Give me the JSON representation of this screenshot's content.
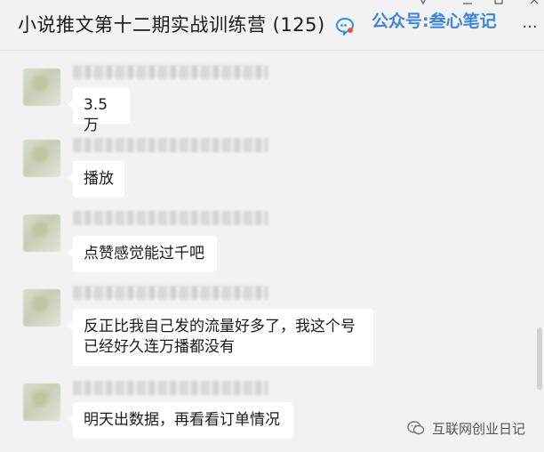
{
  "header": {
    "title": "小说推文第十二期实战训练营 (125)",
    "chat_icon": "chat-bubble-icon",
    "watermark": "公众号:叁心笔记",
    "window_controls": [
      "minimize-icon",
      "maximize-icon",
      "close-icon"
    ],
    "more_icon": "more-icon",
    "more_glyph": "···"
  },
  "messages": [
    {
      "sender": "blurred-name",
      "text": "3.5万"
    },
    {
      "sender": "blurred-name",
      "text": "播放"
    },
    {
      "sender": "blurred-name",
      "text": "点赞感觉能过千吧"
    },
    {
      "sender": "blurred-name",
      "text": "反正比我自己发的流量好多了，我这个号\n已经好久连万播都没有"
    },
    {
      "sender": "blurred-name",
      "text": "明天出数据，再看看订单情况"
    }
  ],
  "footer_watermark": {
    "icon": "wechat-official-account-icon",
    "text": "互联网创业日记"
  },
  "colors": {
    "background": "#f2f2f2",
    "bubble": "#ffffff",
    "watermark_blue": "#3d86d8"
  }
}
